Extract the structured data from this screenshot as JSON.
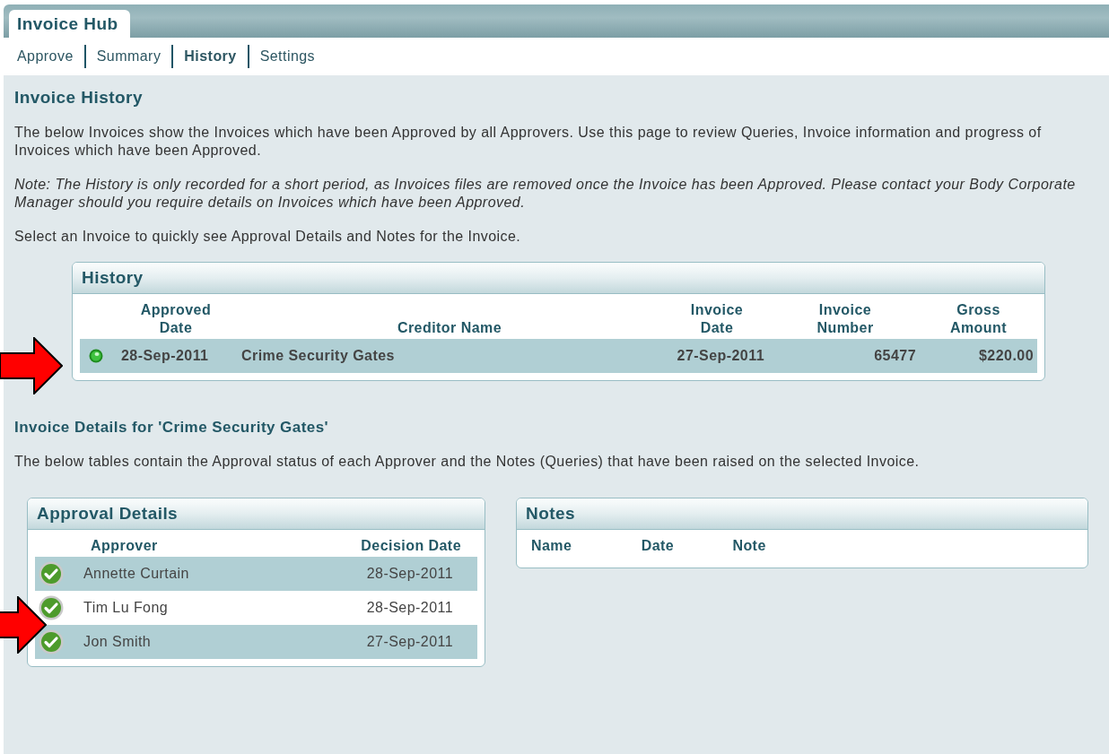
{
  "app_tab": {
    "label": "Invoice Hub",
    "selected": true
  },
  "nav": [
    {
      "label": "Approve",
      "selected": false
    },
    {
      "label": "Summary",
      "selected": false
    },
    {
      "label": "History",
      "selected": true
    },
    {
      "label": "Settings",
      "selected": false
    }
  ],
  "page_title": "Invoice History",
  "intro": "The below Invoices show the Invoices which have been Approved by all Approvers. Use this page to review Queries, Invoice information and progress of Invoices which have been Approved.",
  "note": "Note: The History is only recorded for a short period, as Invoices files are removed once the Invoice has been Approved. Please contact your Body Corporate Manager should you require details on Invoices which have been Approved.",
  "hint": "Select an Invoice to quickly see Approval Details and Notes for the Invoice.",
  "history": {
    "title": "History",
    "columns": [
      "Approved Date",
      "Creditor Name",
      "Invoice Date",
      "Invoice Number",
      "Gross Amount"
    ],
    "rows": [
      {
        "approved_date": "28-Sep-2011",
        "creditor": "Crime Security Gates",
        "invoice_date": "27-Sep-2011",
        "invoice_number": "65477",
        "gross_amount": "$220.00",
        "selected": true
      }
    ]
  },
  "details_title": "Invoice Details for 'Crime Security Gates'",
  "details_text": "The below tables contain the Approval status of each Approver and the Notes (Queries) that have been raised on the selected Invoice.",
  "approvals": {
    "title": "Approval Details",
    "columns": [
      "Approver",
      "Decision Date"
    ],
    "rows": [
      {
        "approver": "Annette Curtain",
        "date": "28-Sep-2011",
        "approved": true
      },
      {
        "approver": "Tim Lu Fong",
        "date": "28-Sep-2011",
        "approved": true
      },
      {
        "approver": "Jon Smith",
        "date": "27-Sep-2011",
        "approved": true
      }
    ]
  },
  "notes": {
    "title": "Notes",
    "columns": [
      "Name",
      "Date",
      "Note"
    ]
  }
}
